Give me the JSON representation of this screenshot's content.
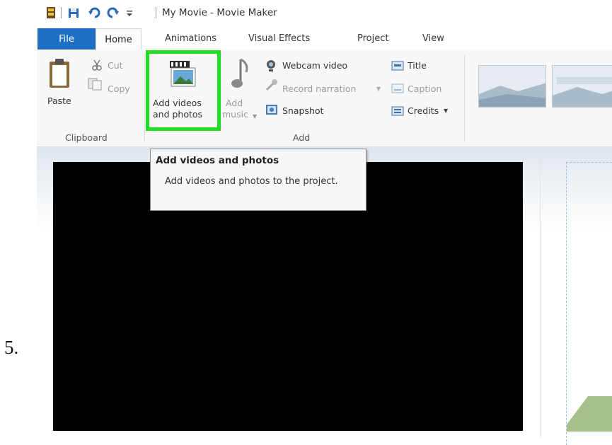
{
  "step_label": "5.",
  "window": {
    "title": "My Movie - Movie Maker"
  },
  "quick_access": [
    "app-icon",
    "save-icon",
    "undo-icon",
    "redo-icon",
    "customize-dropdown-icon"
  ],
  "tabs": [
    {
      "label": "File",
      "active": false
    },
    {
      "label": "Home",
      "active": true
    },
    {
      "label": "Animations"
    },
    {
      "label": "Visual Effects"
    },
    {
      "label": "Project"
    },
    {
      "label": "View"
    }
  ],
  "ribbon": {
    "clipboard": {
      "paste": "Paste",
      "cut": "Cut",
      "copy": "Copy",
      "group_label": "Clipboard"
    },
    "add": {
      "add_videos_line1": "Add videos",
      "add_videos_line2": "and photos",
      "add_music_line1": "Add",
      "add_music_line2": "music",
      "webcam": "Webcam video",
      "narration": "Record narration",
      "snapshot": "Snapshot",
      "title": "Title",
      "caption": "Caption",
      "credits": "Credits",
      "group_label": "Add"
    },
    "themes": [
      "theme-thumbnail-1",
      "theme-thumbnail-2",
      "theme-thumbnail-3"
    ]
  },
  "tooltip": {
    "title": "Add videos and photos",
    "body": "Add videos and photos to the project."
  },
  "colors": {
    "file_tab": "#1f6fc5",
    "highlight": "#22dd22",
    "preview_bg": "#000000"
  }
}
